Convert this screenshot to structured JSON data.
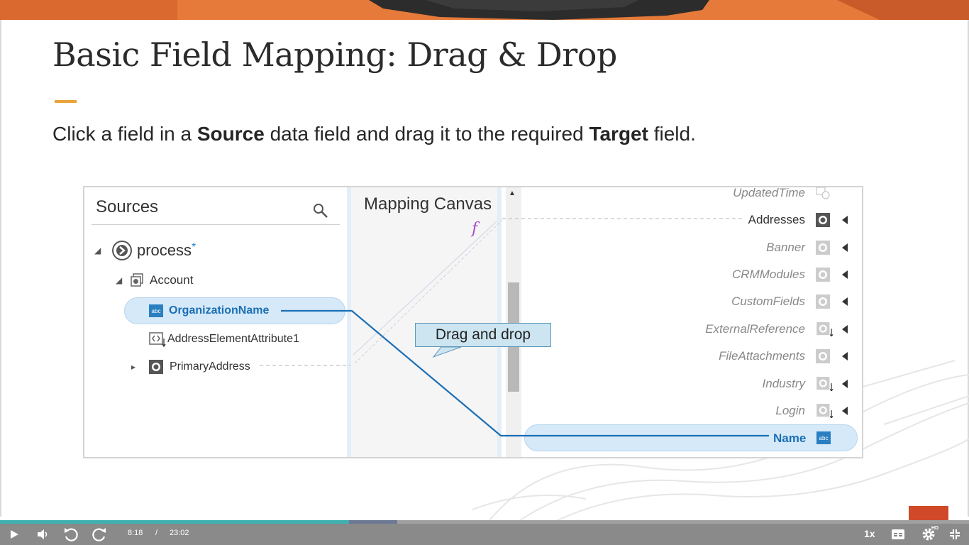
{
  "slide": {
    "title": "Basic Field Mapping: Drag & Drop",
    "instruction": {
      "part1": "Click a field in a ",
      "bold1": "Source",
      "part2": " data field and drag it to the required ",
      "bold2": "Target",
      "part3": " field."
    }
  },
  "sources_panel": {
    "title": "Sources",
    "process_label": "process",
    "process_marker": "*",
    "account_label": "Account",
    "fields": [
      "OrganizationName",
      "AddressElementAttribute1",
      "PrimaryAddress"
    ],
    "abc_badge": "abc"
  },
  "mapping_canvas": {
    "title": "Mapping Canvas",
    "function_icon": "f"
  },
  "targets": [
    {
      "label": "UpdatedTime"
    },
    {
      "label": "Addresses"
    },
    {
      "label": "Banner"
    },
    {
      "label": "CRMModules"
    },
    {
      "label": "CustomFields"
    },
    {
      "label": "ExternalReference"
    },
    {
      "label": "FileAttachments"
    },
    {
      "label": "Industry"
    },
    {
      "label": "Login"
    }
  ],
  "selected_target": {
    "label": "Name",
    "badge": "abc"
  },
  "callout": {
    "text": "Drag and drop"
  },
  "player": {
    "current_time": "8:18",
    "separator": "/",
    "total_time": "23:02",
    "speed": "1x",
    "hd_label": "HD",
    "progress_fraction": 0.36,
    "buffered_fraction": 0.41
  },
  "colors": {
    "accent_rule": "#e8a33a",
    "selection_blue": "#1a6fb5",
    "pill_fill": "#d6e9f8",
    "progress": "#3fb0b0",
    "player_bg": "#8a8a8a",
    "badge_orange": "#d04a2a"
  }
}
